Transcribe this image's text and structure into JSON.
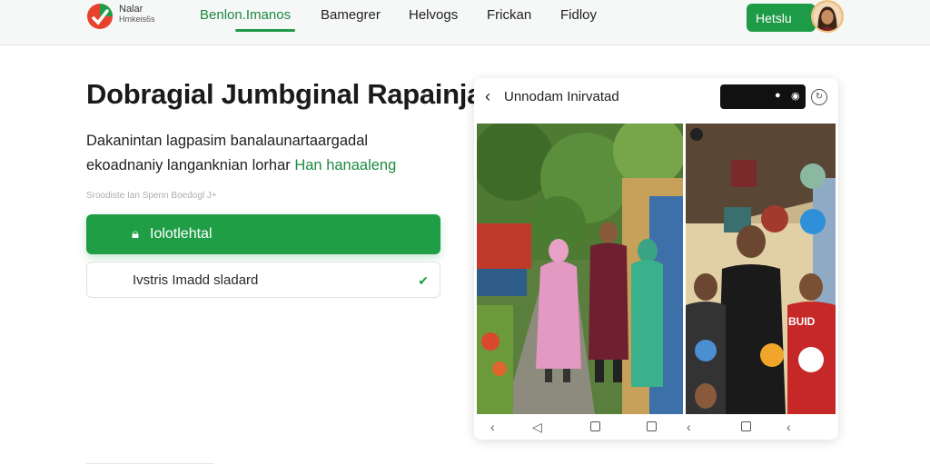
{
  "brand": {
    "line1": "Nalar",
    "line2": "Hmkeis6s"
  },
  "nav": {
    "items": [
      {
        "label": "Benlon.Imanos",
        "active": true
      },
      {
        "label": "Bamegrer",
        "active": false
      },
      {
        "label": "Helvogs",
        "active": false
      },
      {
        "label": "Frickan",
        "active": false
      },
      {
        "label": "Fidloy",
        "active": false
      }
    ],
    "cta_label": "Hetslu"
  },
  "hero": {
    "title": "Dobragial Jumbginal Rapainjad",
    "desc_line1": "Dakanintan lagpasim banalaunartaargadal",
    "desc_line2": "ekoadnaniy langanknian lorhar",
    "desc_highlight": "Han hanaaleng",
    "hint": "Sroodiste Ian Spenn Boedogl J+",
    "primary_button": "Iolotlehtal",
    "select_value": "Ivstris Imadd sladard"
  },
  "card": {
    "title": "Unnodam Inirvatad",
    "photo_badge": "BUID"
  },
  "colors": {
    "accent": "#1f9e45",
    "nav_active": "#1d8a40",
    "card_pill": "#111111"
  },
  "icons": {
    "logo": "brand-logo-icon",
    "primary_button": "lock-icon",
    "select": "chevron-down-icon",
    "card_back": "chevron-left-icon",
    "card_refresh": "refresh-icon"
  }
}
